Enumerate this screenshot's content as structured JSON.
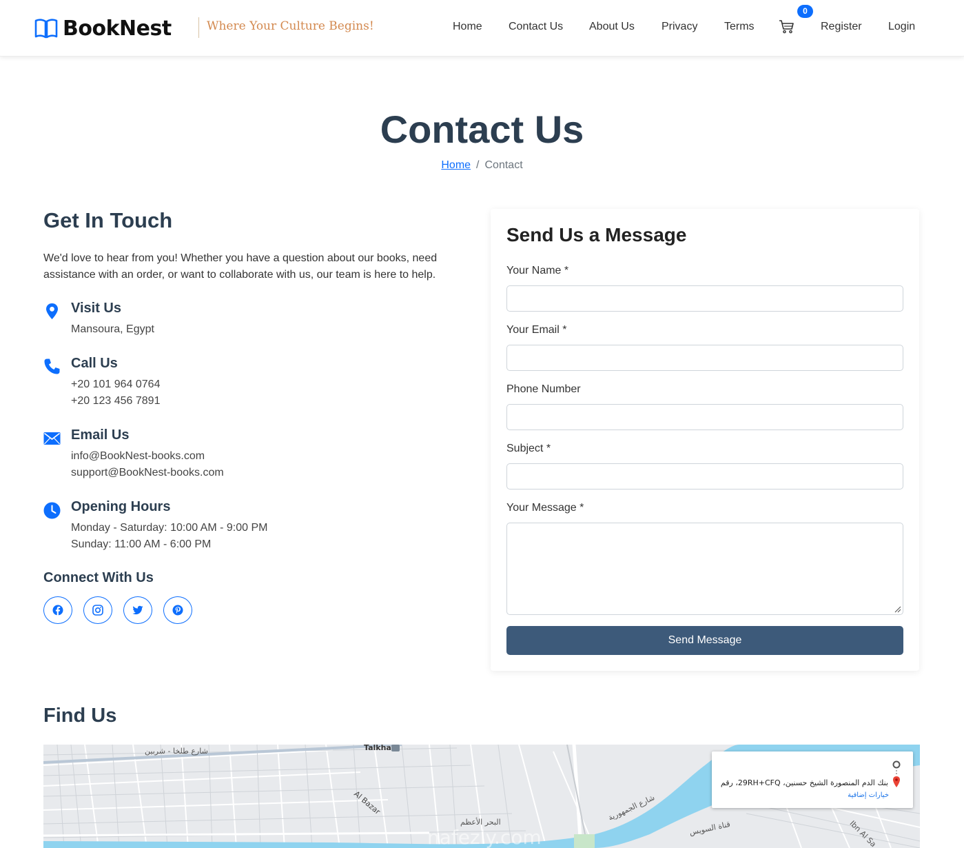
{
  "header": {
    "logo_text": "BookNest",
    "tagline": "Where Your Culture Begins!",
    "nav": [
      "Home",
      "Contact Us",
      "About Us",
      "Privacy",
      "Terms"
    ],
    "cart_count": "0",
    "register": "Register",
    "login": "Login"
  },
  "page": {
    "title": "Contact Us",
    "breadcrumb_home": "Home",
    "breadcrumb_sep": "/",
    "breadcrumb_current": "Contact"
  },
  "contact": {
    "heading": "Get In Touch",
    "intro": "We'd love to hear from you! Whether you have a question about our books, need assistance with an order, or want to collaborate with us, our team is here to help.",
    "visit_title": "Visit Us",
    "visit_line": "Mansoura, Egypt",
    "call_title": "Call Us",
    "phones": [
      "+20 101 964 0764",
      "+20 123 456 7891"
    ],
    "email_title": "Email Us",
    "emails": [
      "info@BookNest-books.com",
      "support@BookNest-books.com"
    ],
    "hours_title": "Opening Hours",
    "hours": [
      "Monday - Saturday: 10:00 AM - 9:00 PM",
      "Sunday: 11:00 AM - 6:00 PM"
    ],
    "connect_title": "Connect With Us",
    "social_icons": [
      "facebook-icon",
      "instagram-icon",
      "twitter-icon",
      "pinterest-icon"
    ]
  },
  "form": {
    "heading": "Send Us a Message",
    "name_label": "Your Name *",
    "email_label": "Your Email *",
    "phone_label": "Phone Number",
    "subject_label": "Subject *",
    "message_label": "Your Message *",
    "submit": "Send Message"
  },
  "map": {
    "heading": "Find Us",
    "address": "بنك الدم المنصورة الشيخ حسنين، 29RH+CFQ، رقم 1...",
    "more_options": "خيارات إضافية",
    "labels": [
      "شارع طلخا - شربين",
      "Talkha",
      "Al Bazar",
      "البحر الأعظم",
      "شارع الجمهورية",
      "قناة السويس",
      "Ibn Al Sa"
    ],
    "watermark": "nafezly.com"
  },
  "colors": {
    "accent": "#0d6efd",
    "button": "#3d5a7a",
    "tagline": "#d3894f",
    "heading": "#2c3e50",
    "river": "#8fd3ef"
  }
}
